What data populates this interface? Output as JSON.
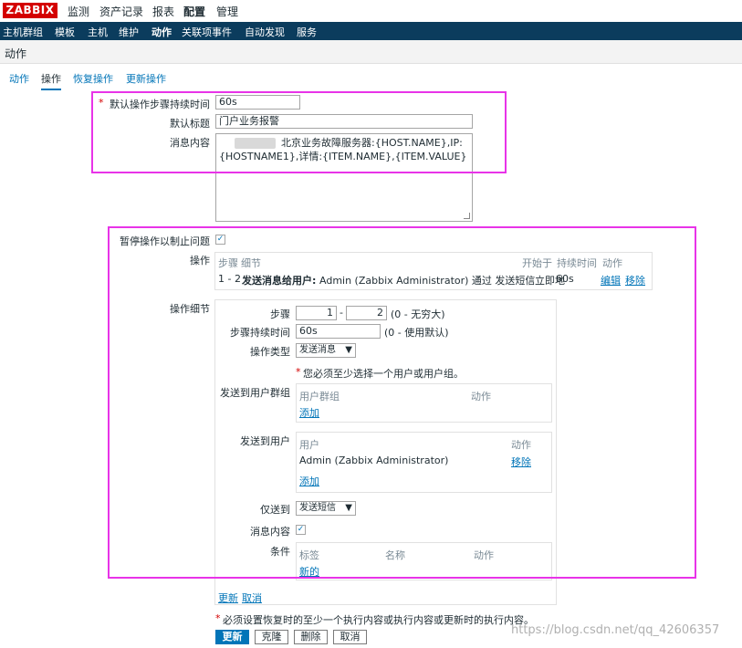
{
  "brand": {
    "logo": "ZABBIX"
  },
  "top_nav": [
    "监测",
    "资产记录",
    "报表",
    "配置",
    "管理"
  ],
  "sub_nav": [
    "主机群组",
    "模板",
    "主机",
    "维护",
    "动作",
    "关联项事件",
    "自动发现",
    "服务"
  ],
  "page": {
    "title": "动作"
  },
  "tabs": [
    "动作",
    "操作",
    "恢复操作",
    "更新操作"
  ],
  "form": {
    "default_step_duration": {
      "label": "默认操作步骤持续时间",
      "value": "60s"
    },
    "default_subject": {
      "label": "默认标题",
      "value": "门户业务报警"
    },
    "message": {
      "label": "消息内容",
      "line1": "北京业务故障服务器:{HOST.NAME},IP:",
      "line2": "{HOSTNAME1},详情:{ITEM.NAME},{ITEM.VALUE}"
    },
    "pause": {
      "label": "暂停操作以制止问题",
      "checked": "✓"
    },
    "operations": {
      "label": "操作",
      "headers": {
        "steps": "步骤",
        "details": "细节",
        "start": "开始于",
        "duration": "持续时间",
        "action": "动作"
      },
      "row": {
        "steps": "1 - 2",
        "details_bold": "发送消息给用户:",
        "details_rest": "Admin (Zabbix Administrator) 通过 发送短信",
        "start": "立即地",
        "duration": "60s",
        "edit": "编辑",
        "remove": "移除"
      }
    },
    "op_details": {
      "label": "操作细节",
      "steps": {
        "label": "步骤",
        "from": "1",
        "sep": "-",
        "to": "2",
        "hint": "(0 - 无穷大)"
      },
      "step_duration": {
        "label": "步骤持续时间",
        "value": "60s",
        "hint": "(0 - 使用默认)"
      },
      "op_type": {
        "label": "操作类型",
        "value": "发送消息",
        "arrow": "▼"
      },
      "warning": {
        "mark": "*",
        "text": "您必须至少选择一个用户或用户组。"
      },
      "send_groups": {
        "label": "发送到用户群组",
        "col1": "用户群组",
        "col2": "动作",
        "add": "添加"
      },
      "send_users": {
        "label": "发送到用户",
        "col1": "用户",
        "col2": "动作",
        "user": "Admin (Zabbix Administrator)",
        "remove": "移除",
        "add": "添加"
      },
      "send_only": {
        "label": "仅送到",
        "value": "发送短信",
        "arrow": "▼"
      },
      "message_content": {
        "label": "消息内容",
        "checked": "✓"
      },
      "conditions": {
        "label": "条件",
        "col1": "标签",
        "col2": "名称",
        "col3": "动作",
        "new": "新的"
      },
      "update_link": "更新",
      "cancel_link": "取消"
    },
    "footer_note": {
      "mark": "*",
      "text": "必须设置恢复时的至少一个执行内容或执行内容或更新时的执行内容。"
    },
    "buttons": {
      "update": "更新",
      "clone": "克隆",
      "delete": "删除",
      "cancel": "取消"
    }
  },
  "watermark": "https://blog.csdn.net/qq_42606357",
  "colors": {
    "brand_red": "#d40000",
    "nav_blue": "#0b3c5d",
    "link_blue": "#0275b8",
    "highlight_magenta": "#e833e8"
  }
}
